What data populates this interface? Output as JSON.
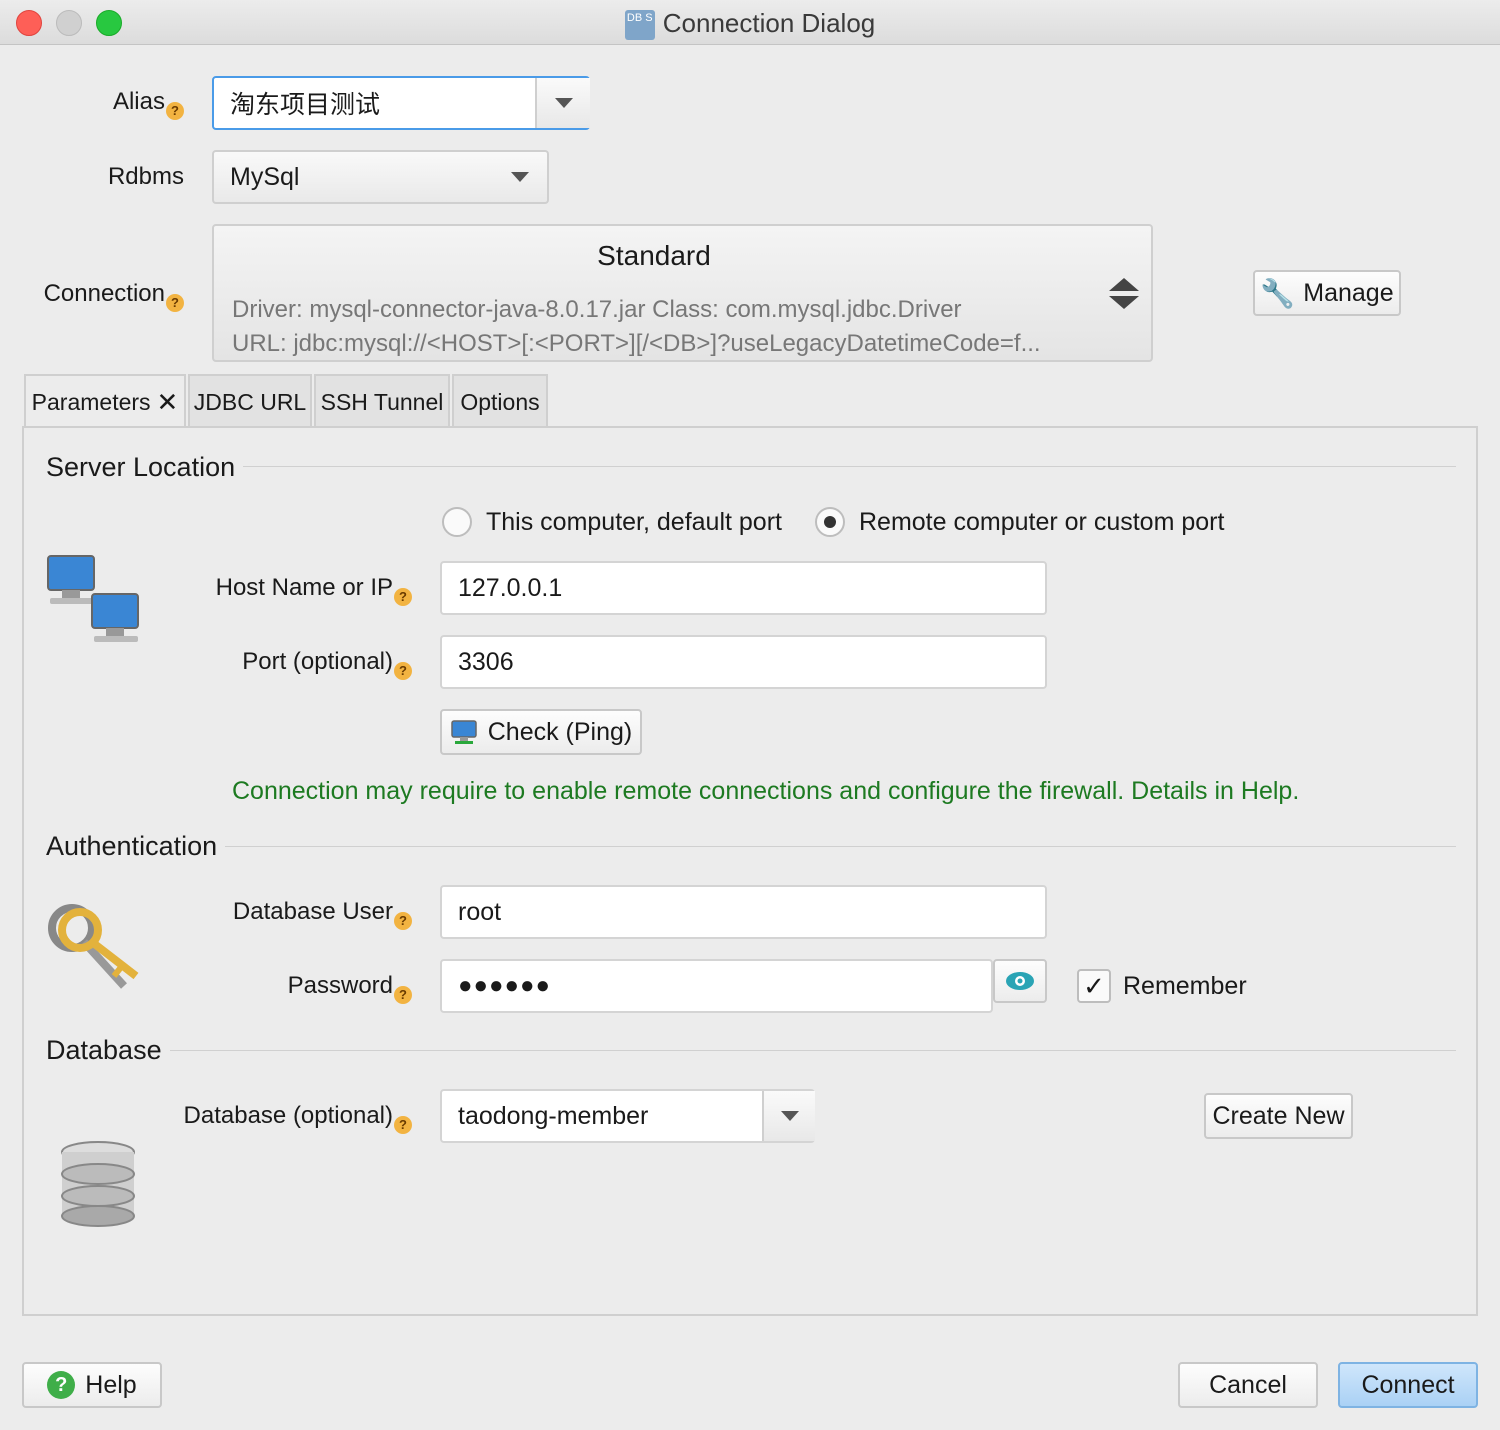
{
  "window": {
    "title": "Connection Dialog",
    "icon_text": "DB S"
  },
  "form": {
    "alias_label": "Alias",
    "alias_value": "淘东项目测试",
    "rdbms_label": "Rdbms",
    "rdbms_value": "MySql",
    "connection_label": "Connection",
    "connection_type": "Standard",
    "driver_text": "Driver: mysql-connector-java-8.0.17.jar Class: com.mysql.jdbc.Driver",
    "url_text": "URL: jdbc:mysql://<HOST>[:<PORT>][/<DB>]?useLegacyDatetimeCode=f...",
    "manage_label": "Manage"
  },
  "tabs": [
    {
      "label": "Parameters"
    },
    {
      "label": "JDBC URL"
    },
    {
      "label": "SSH Tunnel"
    },
    {
      "label": "Options"
    }
  ],
  "server": {
    "section_title": "Server Location",
    "radio_local": "This computer, default port",
    "radio_remote": "Remote computer or custom port",
    "selected": "remote",
    "host_label": "Host Name or IP",
    "host_value": "127.0.0.1",
    "port_label": "Port (optional)",
    "port_value": "3306",
    "ping_label": "Check (Ping)",
    "notice": "Connection may require to enable remote connections and configure the firewall. Details in Help."
  },
  "auth": {
    "section_title": "Authentication",
    "user_label": "Database User",
    "user_value": "root",
    "password_label": "Password",
    "password_mask": "●●●●●●",
    "remember_label": "Remember",
    "remember_checked": true
  },
  "database": {
    "section_title": "Database",
    "db_label": "Database (optional)",
    "db_value": "taodong-member",
    "create_label": "Create New"
  },
  "footer": {
    "help_label": "Help",
    "cancel_label": "Cancel",
    "connect_label": "Connect"
  },
  "colors": {
    "accent": "#4a9be8",
    "notice": "#1d7a21",
    "help_mark": "#f2b341"
  }
}
